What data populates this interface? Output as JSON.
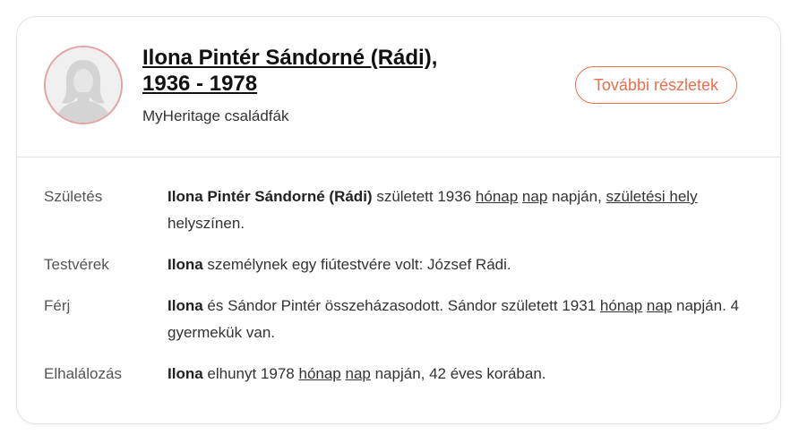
{
  "person": {
    "name_line1": "Ilona Pintér Sándorné (Rádi),",
    "name_line2": "1936 - 1978",
    "source": "MyHeritage családfák",
    "details_button": "További részletek",
    "avatar_icon": "female-silhouette-icon"
  },
  "facts": {
    "birth": {
      "label": "Születés",
      "name": "Ilona Pintér Sándorné (Rádi)",
      "t1": " született 1936 ",
      "link_month": "hónap",
      "t2": " ",
      "link_day": "nap",
      "t3": " napján, ",
      "link_place": "születési hely",
      "t4": " helyszínen."
    },
    "siblings": {
      "label": "Testvérek",
      "name": "Ilona",
      "t1": " személynek egy fiútestvére volt: József Rádi."
    },
    "spouse": {
      "label": "Férj",
      "name": "Ilona",
      "t1": " és Sándor Pintér összeházasodott. Sándor született 1931 ",
      "link_month": "hónap",
      "t2": " ",
      "link_day": "nap",
      "t3": " napján. 4 gyermekük van."
    },
    "death": {
      "label": "Elhalálozás",
      "name": "Ilona",
      "t1": " elhunyt 1978 ",
      "link_month": "hónap",
      "t2": " ",
      "link_day": "nap",
      "t3": " napján, 42 éves korában."
    }
  },
  "colors": {
    "accent": "#e8704d",
    "avatar_border": "#e2a2a6",
    "border": "#e3e3e3"
  }
}
